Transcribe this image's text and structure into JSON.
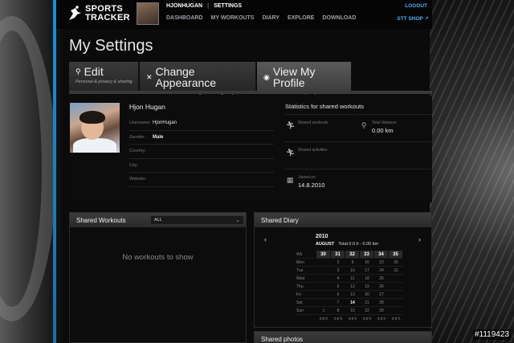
{
  "header": {
    "brand_line1": "SPORTS",
    "brand_line2": "TRACKER",
    "user_nav": [
      "HJONHUGAN",
      "SETTINGS"
    ],
    "main_nav": [
      "DASHBOARD",
      "MY WORKOUTS",
      "DIARY",
      "EXPLORE",
      "DOWNLOAD"
    ],
    "logout": "LOGOUT",
    "shop": "STT SHOP ↗"
  },
  "page": {
    "title": "My Settings"
  },
  "tabs": [
    {
      "title": "Edit",
      "subtitle": "Personal & privacy & sharing",
      "icon": "wrench-icon"
    },
    {
      "title": "Change Appearance",
      "subtitle": "Customize colors and background image to your taste",
      "icon": "tools-icon"
    },
    {
      "title": "View My Profile",
      "subtitle": "View how others see your profile",
      "icon": "eye-icon"
    }
  ],
  "profile": {
    "name": "Hjon Hugan",
    "fields": [
      {
        "key": "Username:",
        "value": "HjonHugan",
        "bold": false
      },
      {
        "key": "Gender:",
        "value": "Male",
        "bold": true
      },
      {
        "key": "Country:",
        "value": "",
        "bold": false
      },
      {
        "key": "City:",
        "value": "",
        "bold": false
      },
      {
        "key": "Website:",
        "value": "",
        "bold": false
      }
    ]
  },
  "stats": {
    "title": "Statistics for shared workouts",
    "shared_workouts_label": "Shared workouts",
    "total_distance_label": "Total distance",
    "total_distance_value": "0.00 km",
    "shared_activities_label": "Shared activities",
    "joined_label": "Joined on",
    "joined_value": "14.8.2010"
  },
  "shared_workouts": {
    "title": "Shared Workouts",
    "filter_value": "ALL",
    "empty_text": "No workouts to show"
  },
  "shared_diary": {
    "title": "Shared Diary",
    "year": "2010",
    "month": "AUGUST",
    "month_total": "Total 0.0 h - 0.00 km",
    "wk_label": "Wk",
    "weeks": [
      "30",
      "31",
      "32",
      "33",
      "34",
      "35"
    ],
    "rows": [
      {
        "day": "Mon",
        "dates": [
          "",
          "2",
          "9",
          "16",
          "23",
          "30"
        ]
      },
      {
        "day": "Tue",
        "dates": [
          "",
          "3",
          "10",
          "17",
          "24",
          "31"
        ]
      },
      {
        "day": "Wed",
        "dates": [
          "",
          "4",
          "11",
          "18",
          "25",
          ""
        ]
      },
      {
        "day": "Thu",
        "dates": [
          "",
          "5",
          "12",
          "19",
          "26",
          ""
        ]
      },
      {
        "day": "Fri",
        "dates": [
          "",
          "6",
          "13",
          "20",
          "27",
          ""
        ]
      },
      {
        "day": "Sat",
        "dates": [
          "",
          "7",
          "14",
          "21",
          "28",
          ""
        ]
      },
      {
        "day": "Sun",
        "dates": [
          "1",
          "8",
          "15",
          "22",
          "29",
          ""
        ]
      }
    ],
    "totals": [
      "0.0 h",
      "0.0 h",
      "0.0 h",
      "0.0 h",
      "0.0 h",
      "0.0 h"
    ]
  },
  "shared_photos": {
    "title": "Shared photos"
  },
  "watermark": "#1119423"
}
